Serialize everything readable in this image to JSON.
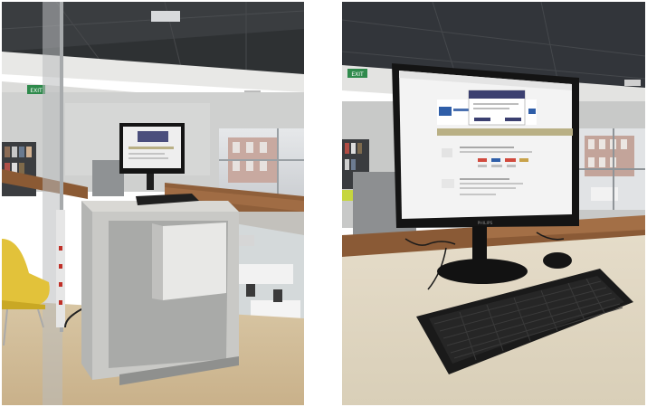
{
  "photos": [
    {
      "subject": "standing-height computer kiosk in library",
      "exit_sign": "EXIT"
    },
    {
      "subject": "close-up of kiosk monitor, keyboard and mouse",
      "exit_sign": "EXIT",
      "monitor_brand": "PHILIPS",
      "colors": {
        "bezel": "#151515",
        "screen": "#f3f3f3",
        "dialog_header": "#3b3f70",
        "olive_band": "#b9b085"
      }
    }
  ]
}
